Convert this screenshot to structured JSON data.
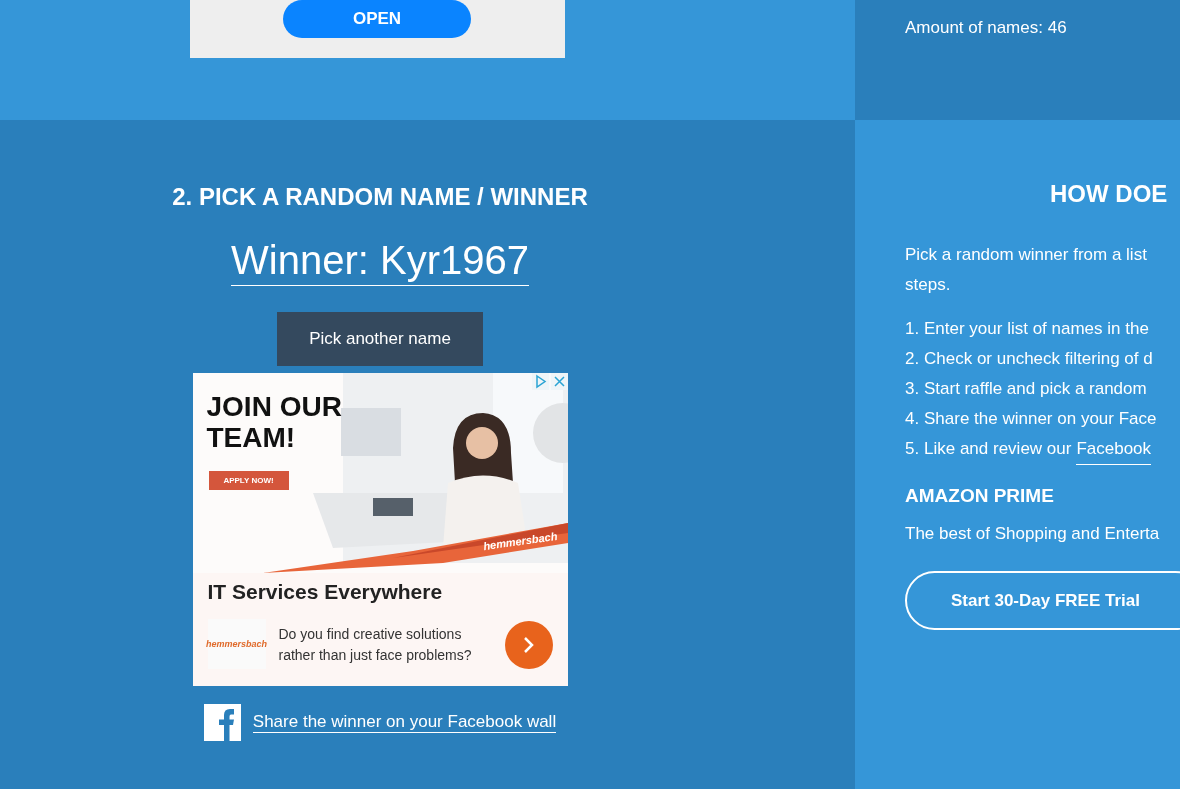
{
  "top": {
    "ad": {
      "button": "OPEN"
    },
    "amount": "Amount of names: 46"
  },
  "pick": {
    "heading": "2. PICK A RANDOM NAME / WINNER",
    "winner": "Winner: Kyr1967",
    "button": "Pick another name",
    "ad": {
      "kind": "picture",
      "headline": "JOIN OUR TEAM!",
      "cta": "APPLY NOW!",
      "brand": "hemmersbach",
      "title": "IT Services Everywhere",
      "logo": "hemmersbach",
      "text": "Do you find creative solutions rather than just face problems?"
    },
    "share": "Share the winner on your Facebook wall"
  },
  "how": {
    "heading": "HOW DOE",
    "intro": [
      "Pick a random winner from a list",
      "steps."
    ],
    "steps": [
      {
        "number": "1.",
        "text": "Enter your list of names in the"
      },
      {
        "number": "2.",
        "text": "Check or uncheck filtering of d"
      },
      {
        "number": "3.",
        "text": "Start raffle and pick a random"
      },
      {
        "number": "4.",
        "text": "Share the winner on your Face"
      },
      {
        "number": "5.",
        "text": "Like and review our",
        "link": "Facebook"
      }
    ],
    "amazon": {
      "heading": "AMAZON PRIME",
      "text": "The best of Shopping and Enterta",
      "button": "Start 30-Day FREE Trial"
    }
  }
}
